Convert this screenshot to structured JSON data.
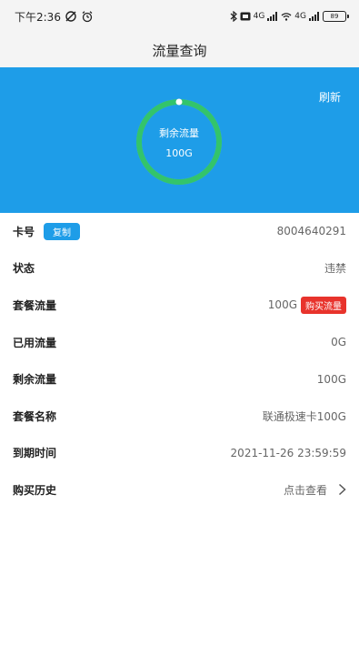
{
  "status_bar": {
    "time": "下午2:36",
    "network_labels": [
      "4G",
      "4G"
    ],
    "battery": "89"
  },
  "nav": {
    "title": "流量查询"
  },
  "hero": {
    "refresh_label": "刷新",
    "ring_label": "剩余流量",
    "ring_value": "100G",
    "remaining_fraction": 1.0,
    "colors": {
      "background": "#1e9de8",
      "ring": "#33c46b"
    }
  },
  "rows": {
    "card": {
      "label": "卡号",
      "copy_label": "复制",
      "value": "8004640291"
    },
    "status": {
      "label": "状态",
      "value": "违禁"
    },
    "package_data": {
      "label": "套餐流量",
      "value": "100G",
      "buy_label": "购买流量"
    },
    "used_data": {
      "label": "已用流量",
      "value": "0G"
    },
    "remaining_data": {
      "label": "剩余流量",
      "value": "100G"
    },
    "package_name": {
      "label": "套餐名称",
      "value": "联通极速卡100G"
    },
    "expiry": {
      "label": "到期时间",
      "value": "2021-11-26 23:59:59"
    },
    "history": {
      "label": "购买历史",
      "value": "点击查看"
    }
  },
  "icons": {
    "status_left": [
      "no-disturb-icon",
      "alarm-icon"
    ],
    "status_right": [
      "bluetooth-icon",
      "hd-icon",
      "signal-icon",
      "wifi-icon",
      "signal-icon",
      "battery-icon"
    ],
    "history": "chevron-right-icon"
  }
}
